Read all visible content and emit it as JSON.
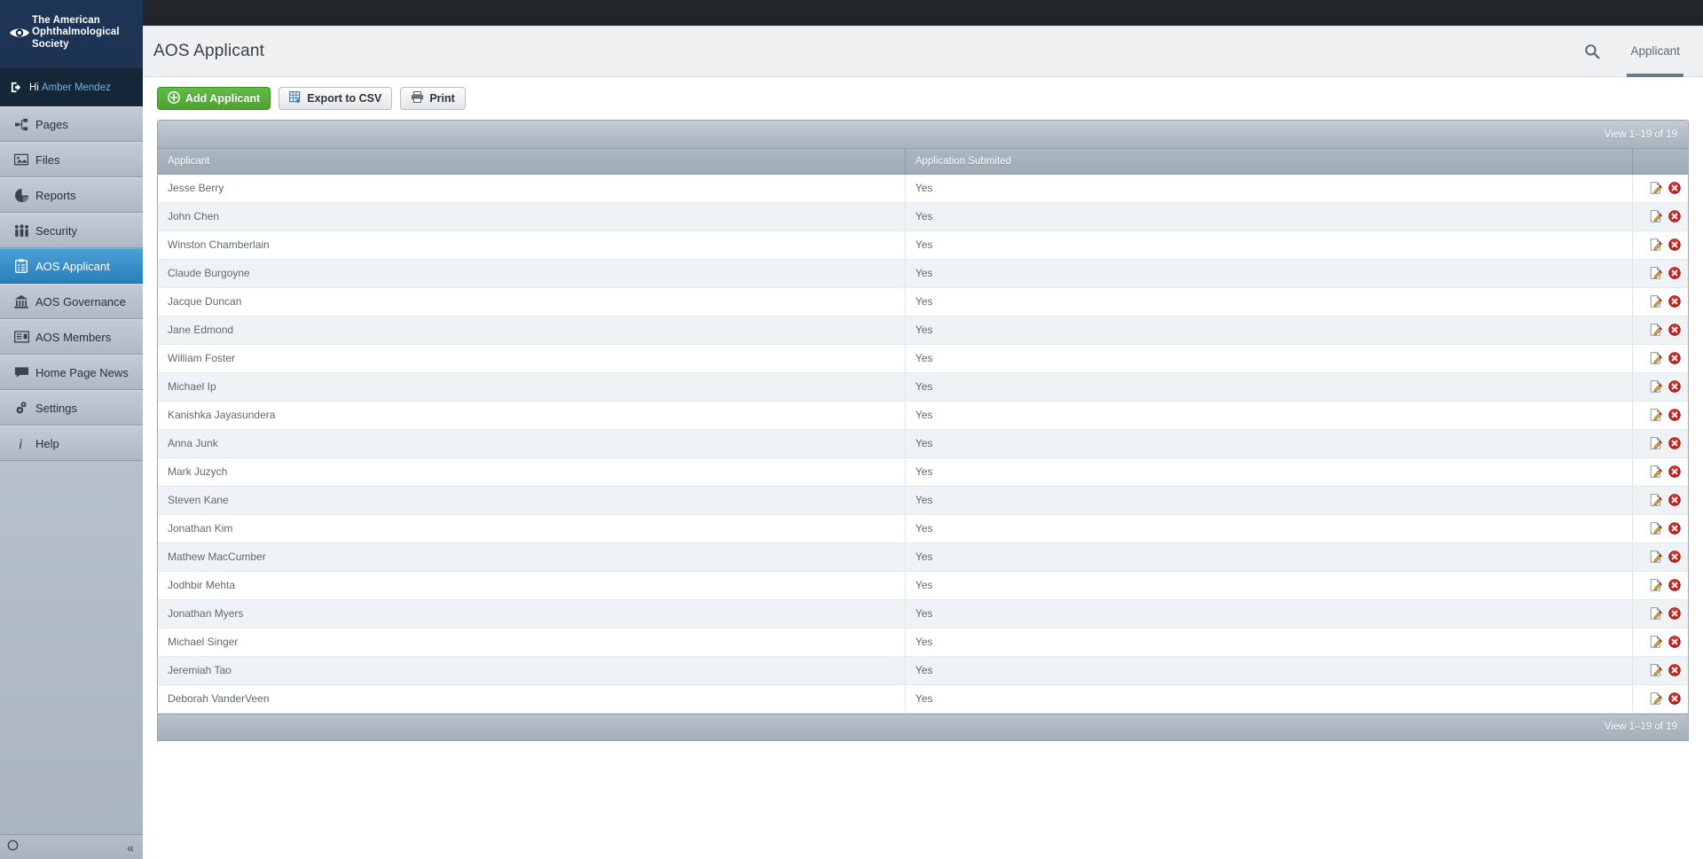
{
  "brand": {
    "name": "The American Ophthalmological Society",
    "icon": "eye-icon"
  },
  "user": {
    "greeting": "Hi",
    "name": "Amber Mendez",
    "icon": "logout-icon"
  },
  "sidebar": {
    "items": [
      {
        "label": "Pages",
        "icon": "sitemap-icon",
        "active": false
      },
      {
        "label": "Files",
        "icon": "image-icon",
        "active": false
      },
      {
        "label": "Reports",
        "icon": "piechart-icon",
        "active": false
      },
      {
        "label": "Security",
        "icon": "people-icon",
        "active": false
      },
      {
        "label": "AOS Applicant",
        "icon": "clipboard-icon",
        "active": true
      },
      {
        "label": "AOS Governance",
        "icon": "bank-icon",
        "active": false
      },
      {
        "label": "AOS Members",
        "icon": "idcard-icon",
        "active": false
      },
      {
        "label": "Home Page News",
        "icon": "comment-icon",
        "active": false
      },
      {
        "label": "Settings",
        "icon": "gears-icon",
        "active": false
      },
      {
        "label": "Help",
        "icon": "info-icon",
        "active": false
      }
    ],
    "footer": {
      "status_icon": "circle-icon",
      "collapse_label": "«"
    }
  },
  "header": {
    "title": "AOS Applicant",
    "search_icon": "search-icon",
    "tabs": [
      {
        "label": "Applicant",
        "active": true
      }
    ]
  },
  "toolbar": {
    "add_label": "Add Applicant",
    "add_icon": "plus-circle-icon",
    "export_label": "Export to CSV",
    "export_icon": "spreadsheet-icon",
    "print_label": "Print",
    "print_icon": "printer-icon"
  },
  "grid": {
    "view_range_top": "View 1–19 of 19",
    "view_range_bottom": "View 1–19 of 19",
    "columns": [
      "Applicant",
      "Application Submited",
      ""
    ],
    "row_actions": {
      "edit_icon": "edit-page-icon",
      "delete_icon": "delete-circle-icon"
    },
    "rows": [
      {
        "applicant": "Jesse Berry",
        "submitted": "Yes"
      },
      {
        "applicant": "John Chen",
        "submitted": "Yes"
      },
      {
        "applicant": "Winston Chamberlain",
        "submitted": "Yes"
      },
      {
        "applicant": "Claude Burgoyne",
        "submitted": "Yes"
      },
      {
        "applicant": "Jacque Duncan",
        "submitted": "Yes"
      },
      {
        "applicant": "Jane Edmond",
        "submitted": "Yes"
      },
      {
        "applicant": "William Foster",
        "submitted": "Yes"
      },
      {
        "applicant": "Michael Ip",
        "submitted": "Yes"
      },
      {
        "applicant": "Kanishka Jayasundera",
        "submitted": "Yes"
      },
      {
        "applicant": "Anna Junk",
        "submitted": "Yes"
      },
      {
        "applicant": "Mark Juzych",
        "submitted": "Yes"
      },
      {
        "applicant": "Steven Kane",
        "submitted": "Yes"
      },
      {
        "applicant": "Jonathan Kim",
        "submitted": "Yes"
      },
      {
        "applicant": "Mathew MacCumber",
        "submitted": "Yes"
      },
      {
        "applicant": "Jodhbir Mehta",
        "submitted": "Yes"
      },
      {
        "applicant": "Jonathan Myers",
        "submitted": "Yes"
      },
      {
        "applicant": "Michael Singer",
        "submitted": "Yes"
      },
      {
        "applicant": "Jeremiah Tao",
        "submitted": "Yes"
      },
      {
        "applicant": "Deborah VanderVeen",
        "submitted": "Yes"
      }
    ]
  },
  "colors": {
    "sidebar_top": "#1d3456",
    "nav_bg": "#b7c2cd",
    "nav_active": "#2f86c1",
    "accent_link": "#73b3e0",
    "add_button_green": "#4ca42f",
    "grid_header": "#a3afba",
    "delete_red": "#c9211e"
  }
}
